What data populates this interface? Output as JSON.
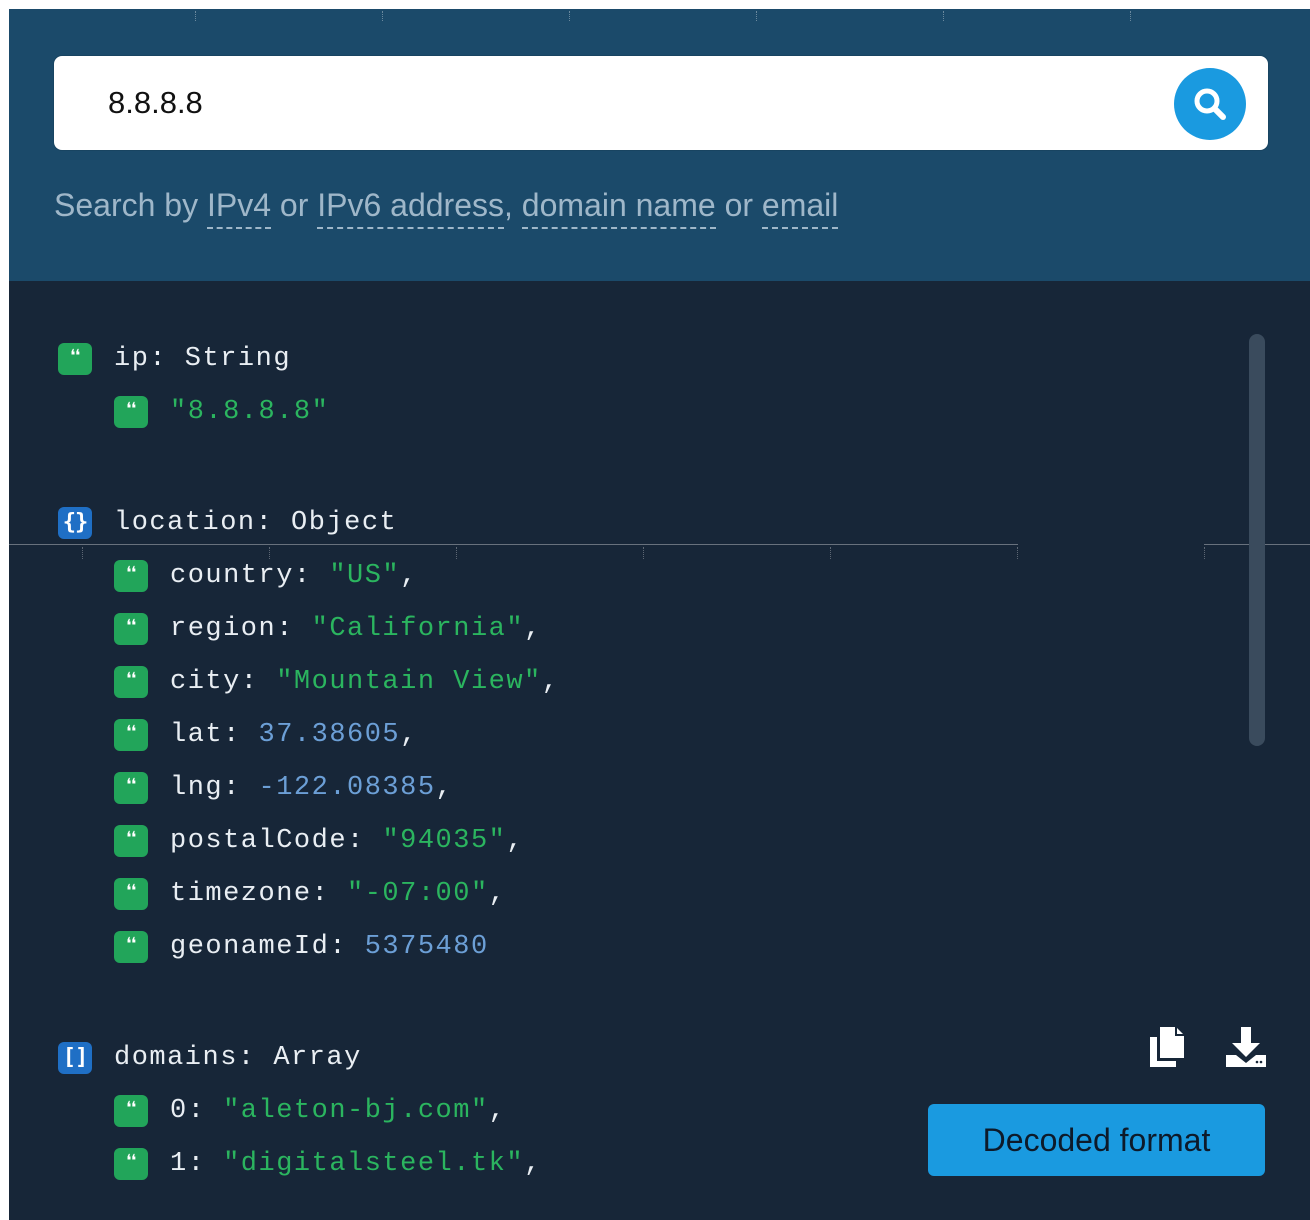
{
  "search": {
    "value": "8.8.8.8",
    "placeholder": ""
  },
  "hint": {
    "prefix": "Search by ",
    "ipv4": "IPv4",
    "or1": " or ",
    "ipv6": "IPv6 address",
    "comma": ", ",
    "domain": "domain name",
    "or2": " or ",
    "email": "email"
  },
  "result": {
    "ip": {
      "key": "ip: String",
      "value": "\"8.8.8.8\""
    },
    "location": {
      "key": "location: Object",
      "fields": [
        {
          "key": "country: ",
          "value": "\"US\"",
          "kind": "str",
          "sep": ","
        },
        {
          "key": "region: ",
          "value": "\"California\"",
          "kind": "str",
          "sep": ","
        },
        {
          "key": "city: ",
          "value": "\"Mountain View\"",
          "kind": "str",
          "sep": ","
        },
        {
          "key": "lat: ",
          "value": "37.38605",
          "kind": "num",
          "sep": ","
        },
        {
          "key": "lng: ",
          "value": "-122.08385",
          "kind": "num",
          "sep": ","
        },
        {
          "key": "postalCode: ",
          "value": "\"94035\"",
          "kind": "str",
          "sep": ","
        },
        {
          "key": "timezone: ",
          "value": "\"-07:00\"",
          "kind": "str",
          "sep": ","
        },
        {
          "key": "geonameId: ",
          "value": "5375480",
          "kind": "num",
          "sep": ""
        }
      ]
    },
    "domains": {
      "key": "domains: Array",
      "items": [
        {
          "key": "0: ",
          "value": "\"aleton-bj.com\"",
          "kind": "str",
          "sep": ","
        },
        {
          "key": "1: ",
          "value": "\"digitalsteel.tk\"",
          "kind": "str",
          "sep": ","
        }
      ]
    }
  },
  "actions": {
    "copy_icon": "copy-icon",
    "download_icon": "download-icon",
    "decoded_label": "Decoded format"
  },
  "colors": {
    "header_bg": "#1b4a6a",
    "body_bg": "#172638",
    "accent": "#1a9ae0",
    "string": "#2bb55f",
    "number": "#6c9fd6"
  }
}
